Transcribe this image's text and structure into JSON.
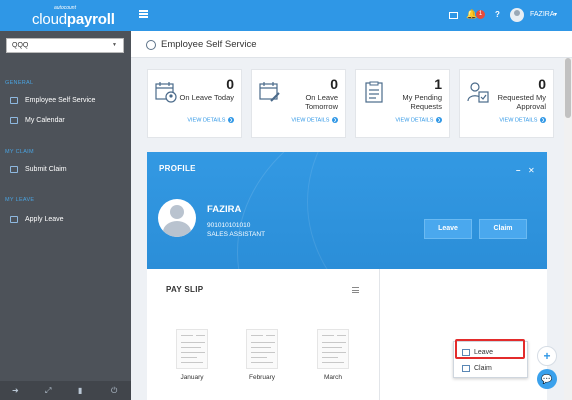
{
  "app": {
    "logo_small": "autocount",
    "logo_main_a": "cloud",
    "logo_main_b": "payroll"
  },
  "topbar": {
    "notification_count": "1",
    "help_label": "?",
    "user_name": "FAZIRA"
  },
  "sidebar": {
    "company": "QQQ",
    "sections": [
      {
        "title": "GENERAL",
        "items": [
          "Employee Self Service",
          "My Calendar"
        ]
      },
      {
        "title": "MY CLAIM",
        "items": [
          "Submit Claim"
        ]
      },
      {
        "title": "MY LEAVE",
        "items": [
          "Apply Leave"
        ]
      }
    ]
  },
  "header": {
    "title": "Employee Self Service"
  },
  "cards": [
    {
      "value": "0",
      "label": "On Leave Today",
      "link": "VIEW DETAILS"
    },
    {
      "value": "0",
      "label": "On Leave Tomorrow",
      "link": "VIEW DETAILS"
    },
    {
      "value": "1",
      "label": "My Pending Requests",
      "link": "VIEW DETAILS"
    },
    {
      "value": "0",
      "label": "Requested My Approval",
      "link": "VIEW DETAILS"
    }
  ],
  "profile": {
    "title": "PROFILE",
    "name": "FAZIRA",
    "employee_id": "901010101010",
    "position": "SALES ASSISTANT",
    "leave_button": "Leave",
    "claim_button": "Claim"
  },
  "payslip": {
    "title": "PAY SLIP",
    "months": [
      "January",
      "February",
      "March"
    ]
  },
  "fab": {
    "leave": "Leave",
    "claim": "Claim",
    "plus": "+"
  }
}
